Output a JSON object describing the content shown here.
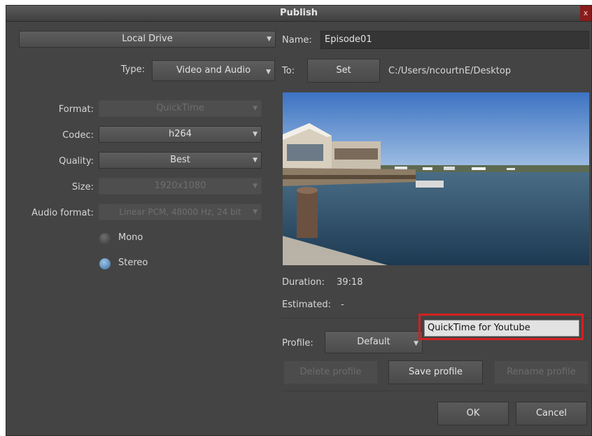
{
  "window": {
    "title": "Publish",
    "close_glyph": "x"
  },
  "destination": {
    "value": "Local Drive"
  },
  "type": {
    "label": "Type:",
    "value": "Video and Audio"
  },
  "name": {
    "label": "Name:",
    "value": "Episode01"
  },
  "to": {
    "label": "To:",
    "set_button": "Set",
    "path": "C:/Users/ncourtnE/Desktop"
  },
  "format": {
    "label": "Format:",
    "value": "QuickTime"
  },
  "codec": {
    "label": "Codec:",
    "value": "h264"
  },
  "quality": {
    "label": "Quality:",
    "value": "Best"
  },
  "size": {
    "label": "Size:",
    "value": "1920x1080"
  },
  "audio_format": {
    "label": "Audio format:",
    "value": "Linear PCM, 48000 Hz, 24 bit"
  },
  "channels": {
    "mono": "Mono",
    "stereo": "Stereo",
    "selected": "Stereo"
  },
  "duration": {
    "label": "Duration:",
    "value": "39:18"
  },
  "estimated": {
    "label": "Estimated:",
    "value": "-"
  },
  "profile": {
    "label": "Profile:",
    "value": "Default",
    "name_value": "QuickTime for Youtube"
  },
  "profile_buttons": {
    "delete": "Delete profile",
    "save": "Save profile",
    "rename": "Rename profile"
  },
  "footer": {
    "ok": "OK",
    "cancel": "Cancel"
  },
  "icons": [
    "close-icon",
    "dropdown-caret-icon",
    "radio-icon"
  ],
  "colors": {
    "window_bg": "#444444",
    "highlight": "#d32020",
    "radio_on": "#4a7cab"
  }
}
